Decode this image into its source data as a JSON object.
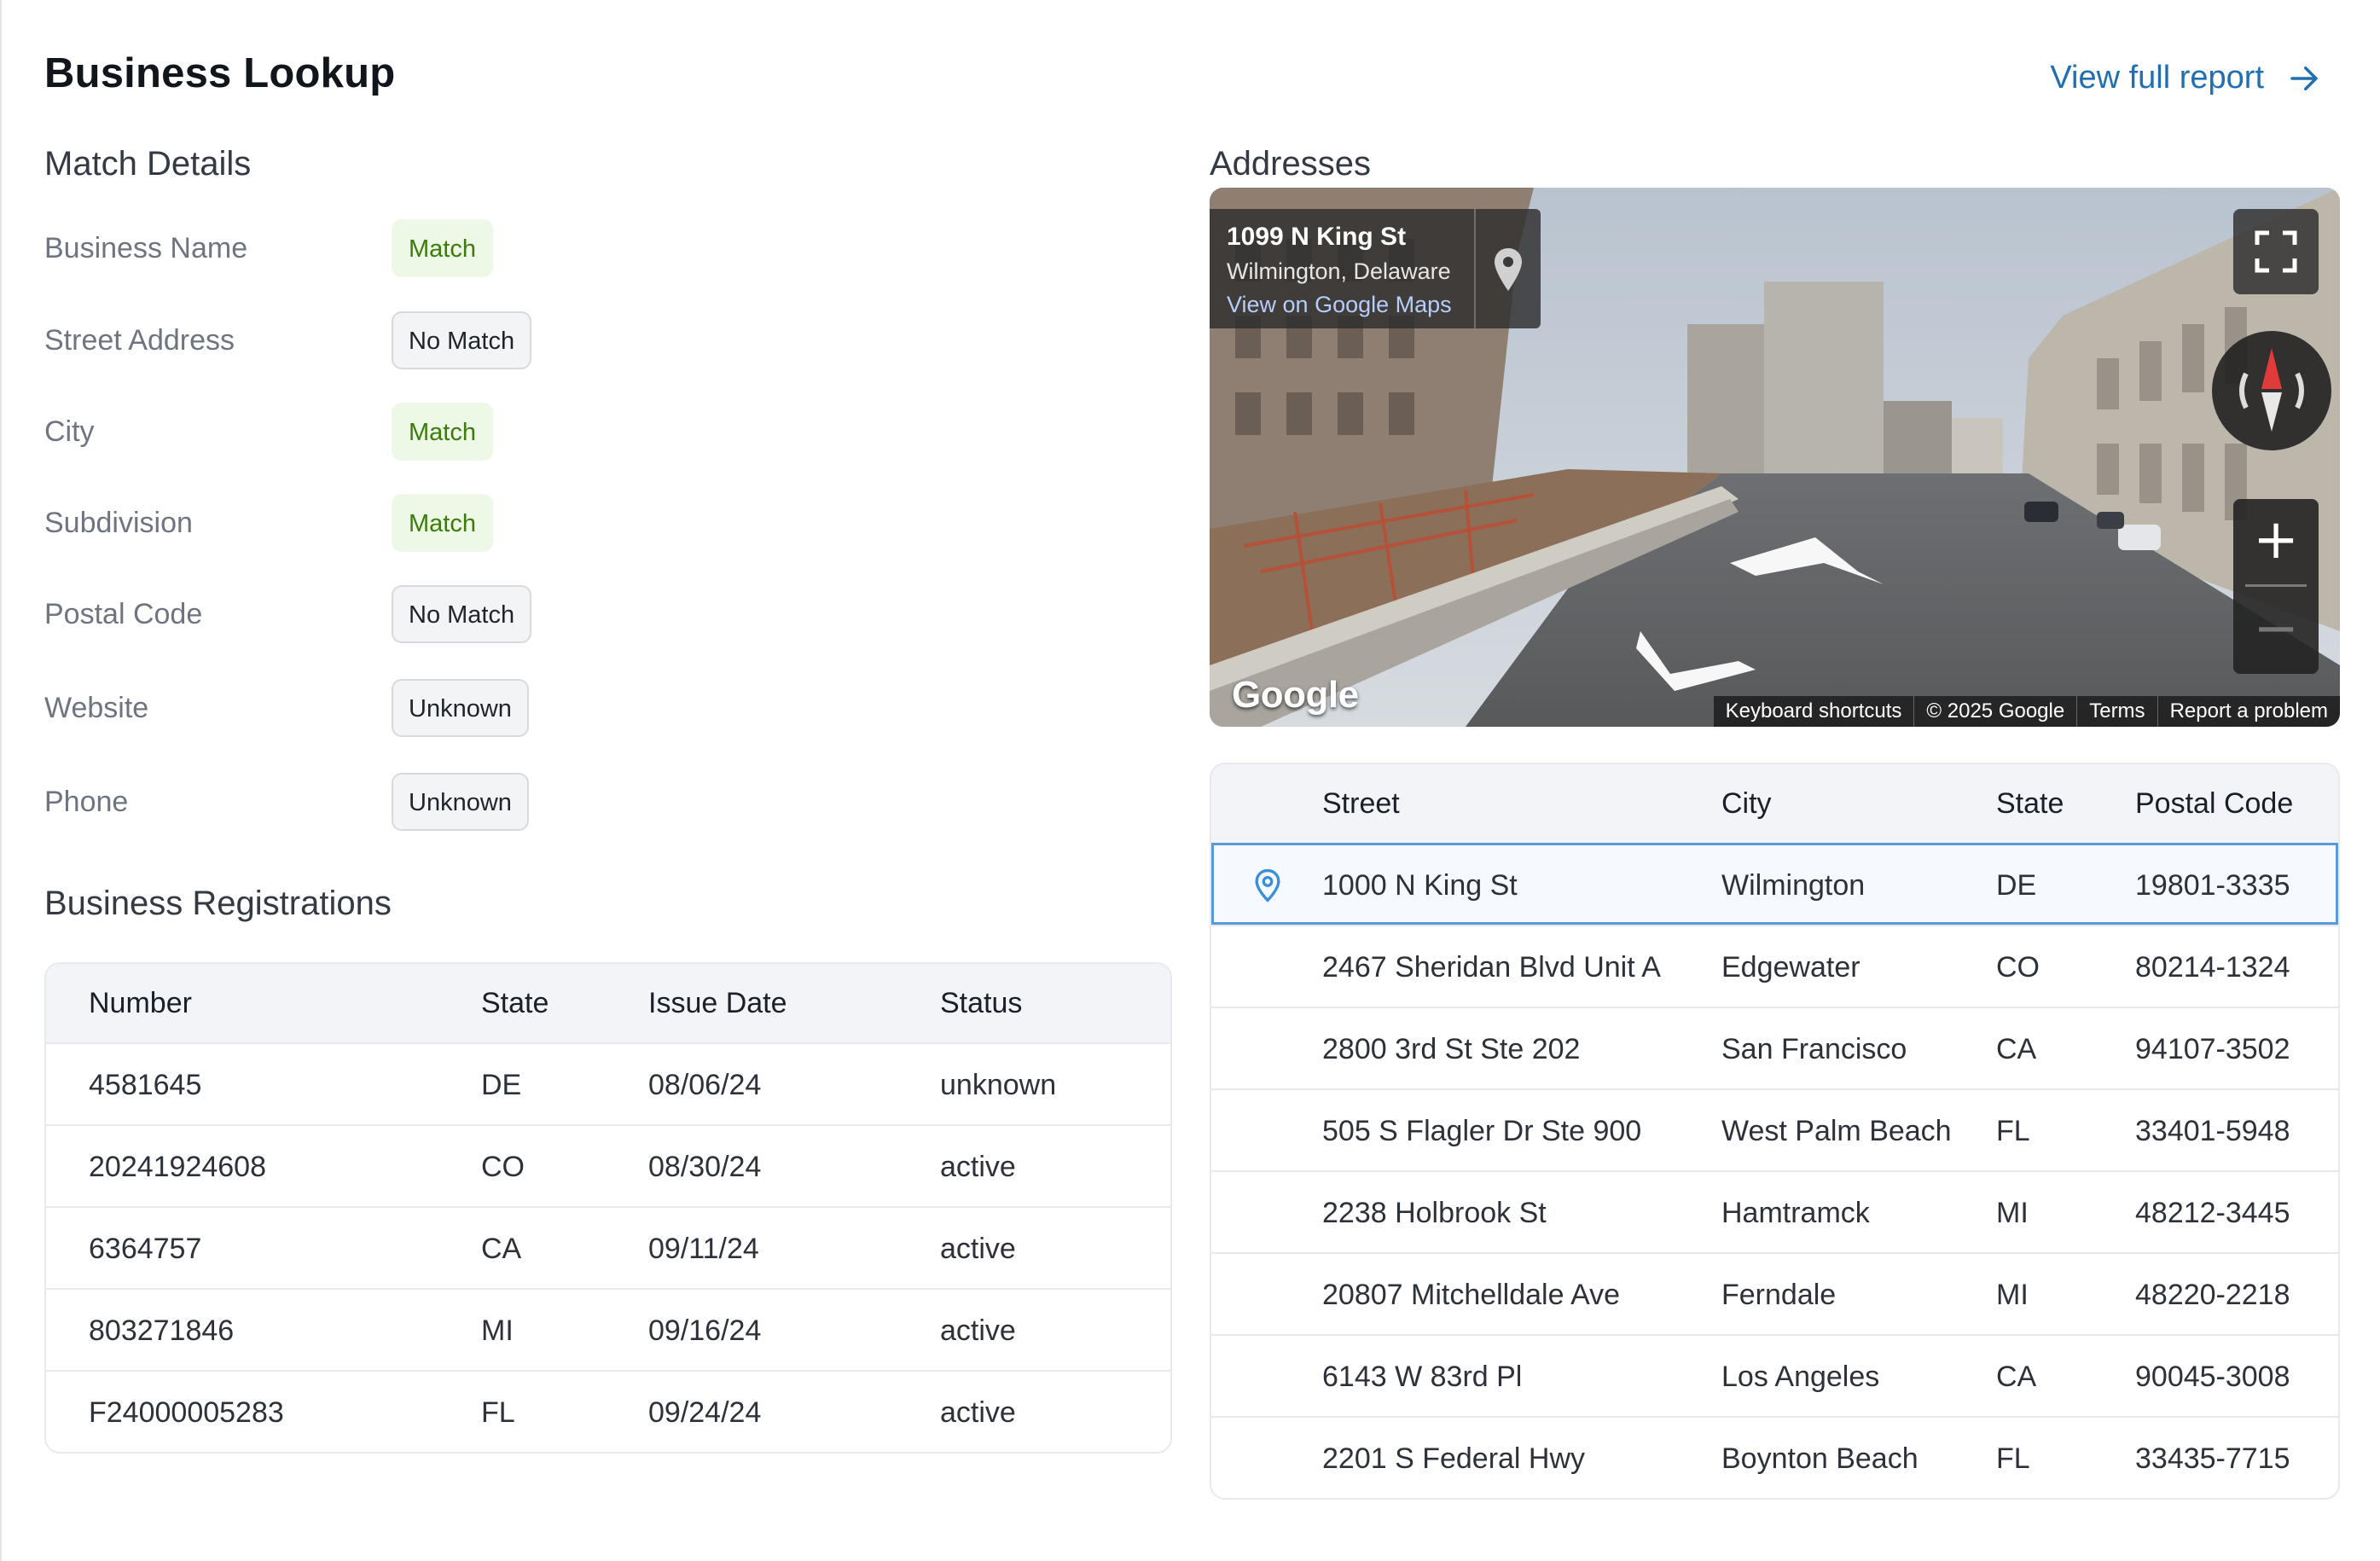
{
  "header": {
    "title": "Business Lookup",
    "report_link": "View full report"
  },
  "match_details": {
    "title": "Match Details",
    "rows": [
      {
        "label": "Business Name",
        "status": "Match"
      },
      {
        "label": "Street Address",
        "status": "No Match"
      },
      {
        "label": "City",
        "status": "Match"
      },
      {
        "label": "Subdivision",
        "status": "Match"
      },
      {
        "label": "Postal Code",
        "status": "No Match"
      },
      {
        "label": "Website",
        "status": "Unknown"
      },
      {
        "label": "Phone",
        "status": "Unknown"
      }
    ]
  },
  "registrations": {
    "title": "Business Registrations",
    "columns": [
      "Number",
      "State",
      "Issue Date",
      "Status"
    ],
    "rows": [
      [
        "4581645",
        "DE",
        "08/06/24",
        "unknown"
      ],
      [
        "20241924608",
        "CO",
        "08/30/24",
        "active"
      ],
      [
        "6364757",
        "CA",
        "09/11/24",
        "active"
      ],
      [
        "803271846",
        "MI",
        "09/16/24",
        "active"
      ],
      [
        "F24000005283",
        "FL",
        "09/24/24",
        "active"
      ]
    ]
  },
  "addresses": {
    "title": "Addresses",
    "columns": [
      "Street",
      "City",
      "State",
      "Postal Code"
    ],
    "selected_index": 0,
    "rows": [
      [
        "1000 N King St",
        "Wilmington",
        "DE",
        "19801-3335"
      ],
      [
        "2467 Sheridan Blvd Unit A",
        "Edgewater",
        "CO",
        "80214-1324"
      ],
      [
        "2800 3rd St Ste 202",
        "San Francisco",
        "CA",
        "94107-3502"
      ],
      [
        "505 S Flagler Dr Ste 900",
        "West Palm Beach",
        "FL",
        "33401-5948"
      ],
      [
        "2238 Holbrook St",
        "Hamtramck",
        "MI",
        "48212-3445"
      ],
      [
        "20807 Mitchelldale Ave",
        "Ferndale",
        "MI",
        "48220-2218"
      ],
      [
        "6143 W 83rd Pl",
        "Los Angeles",
        "CA",
        "90045-3008"
      ],
      [
        "2201 S Federal Hwy",
        "Boynton Beach",
        "FL",
        "33435-7715"
      ]
    ]
  },
  "street_view": {
    "address": "1099 N King St",
    "region": "Wilmington, Delaware",
    "maps_link": "View on Google Maps",
    "logo": "Google",
    "attribution": [
      "Keyboard shortcuts",
      "© 2025 Google",
      "Terms",
      "Report a problem"
    ],
    "zoom_in": "+",
    "zoom_out": "−"
  },
  "icons": {
    "arrow": "arrow-right-icon",
    "pin": "map-pin-icon",
    "fullscreen": "fullscreen-icon",
    "compass": "compass-icon"
  },
  "colors": {
    "link": "#1f6fb2",
    "match_bg": "#eef8e6",
    "match_text": "#3b7c0a",
    "selected_outline": "#5b9bd5"
  }
}
